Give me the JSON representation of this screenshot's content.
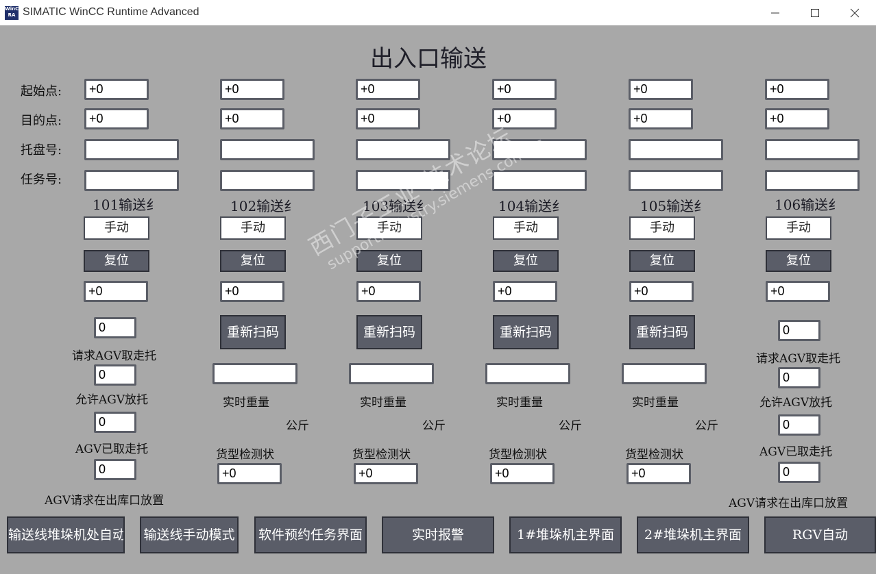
{
  "window": {
    "icon_text": "WinCC RA",
    "title": "SIMATIC WinCC Runtime Advanced",
    "controls": [
      "minimize-icon",
      "maximize-icon",
      "close-icon"
    ]
  },
  "screen_title": "出入口输送",
  "row_labels": {
    "start": "起始点:",
    "target": "目的点:",
    "pallet": "托盘号:",
    "task": "任务号:"
  },
  "sections": [
    {
      "label": "101输送纟",
      "start": "+0",
      "target": "+0",
      "pallet": "",
      "task": "",
      "manual": "手动",
      "reset": "复位",
      "value": "+0"
    },
    {
      "label": "102输送纟",
      "start": "+0",
      "target": "+0",
      "pallet": "",
      "task": "",
      "manual": "手动",
      "reset": "复位",
      "value": "+0",
      "rescan": "重新扫码",
      "weight": "",
      "weight_label": "实时重量",
      "unit": "公斤",
      "type_label": "货型检测状",
      "type_value": "+0"
    },
    {
      "label": "103输送纟",
      "start": "+0",
      "target": "+0",
      "pallet": "",
      "task": "",
      "manual": "手动",
      "reset": "复位",
      "value": "+0",
      "rescan": "重新扫码",
      "weight": "",
      "weight_label": "实时重量",
      "unit": "公斤",
      "type_label": "货型检测状",
      "type_value": "+0"
    },
    {
      "label": "104输送纟",
      "start": "+0",
      "target": "+0",
      "pallet": "",
      "task": "",
      "manual": "手动",
      "reset": "复位",
      "value": "+0",
      "rescan": "重新扫码",
      "weight": "",
      "weight_label": "实时重量",
      "unit": "公斤",
      "type_label": "货型检测状",
      "type_value": "+0"
    },
    {
      "label": "105输送纟",
      "start": "+0",
      "target": "+0",
      "pallet": "",
      "task": "",
      "manual": "手动",
      "reset": "复位",
      "value": "+0",
      "rescan": "重新扫码",
      "weight": "",
      "weight_label": "实时重量",
      "unit": "公斤",
      "type_label": "货型检测状",
      "type_value": "+0"
    },
    {
      "label": "106输送纟",
      "start": "+0",
      "target": "+0",
      "pallet": "",
      "task": "",
      "manual": "手动",
      "reset": "复位",
      "value": "+0"
    }
  ],
  "agv_left": {
    "signals": [
      {
        "value": "0",
        "label": "请求AGV取走托"
      },
      {
        "value": "0",
        "label": "允许AGV放托"
      },
      {
        "value": "0",
        "label": "AGV已取走托"
      },
      {
        "value": "0",
        "label": "AGV请求在出库口放置"
      }
    ]
  },
  "agv_right": {
    "signals": [
      {
        "value": "0",
        "label": "请求AGV取走托"
      },
      {
        "value": "0",
        "label": "允许AGV放托"
      },
      {
        "value": "0",
        "label": "AGV已取走托"
      },
      {
        "value": "0",
        "label": "AGV请求在出库口放置"
      }
    ]
  },
  "nav_buttons": [
    "输送线堆垛机处自动",
    "输送线手动模式",
    "软件预约任务界面",
    "实时报警",
    "1#堆垛机主界面",
    "2#堆垛机主界面",
    "RGV自动"
  ],
  "watermark": {
    "line1": "西门子工业 技术论坛",
    "line2": "support.industry.siemens.com/cs"
  },
  "colors": {
    "background": "#a8a8a8",
    "button": "#5a5d68",
    "field_border": "#5b5e67"
  }
}
